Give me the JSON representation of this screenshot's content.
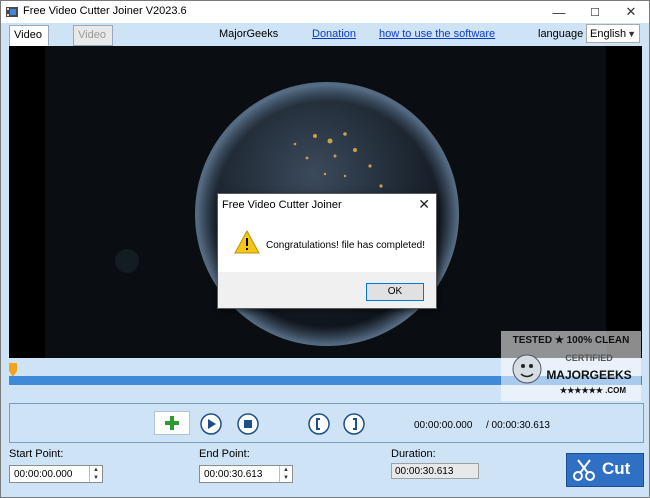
{
  "window": {
    "title": "Free Video Cutter Joiner V2023.6",
    "minimize_icon": "minimize-icon",
    "maximize_icon": "maximize-icon",
    "close_icon": "close-icon"
  },
  "tabs": [
    {
      "label": "Video Cutter",
      "active": true
    },
    {
      "label": "Video Joiner",
      "active": false
    }
  ],
  "topbar": {
    "site": "MajorGeeks",
    "donation": "Donation",
    "howto": "how to use the software",
    "language_label": "language",
    "language_value": "English"
  },
  "dialog": {
    "title": "Congratulations! file has completed!",
    "window_title": "Free Video Cutter Joiner",
    "message": "Congratulations! file has completed!",
    "ok": "OK",
    "icon": "warning-icon"
  },
  "timeline": {
    "position": 0.0
  },
  "controls": {
    "current_time": "00:00:00.000",
    "total_time": "/ 00:00:30.613",
    "icons": [
      "add-icon",
      "play-icon",
      "stop-icon",
      "mark-in-icon",
      "mark-out-icon"
    ]
  },
  "fields": {
    "start_label": "Start Point:",
    "start_value": "00:00:00.000",
    "end_label": "End Point:",
    "end_value": "00:00:30.613",
    "duration_label": "Duration:",
    "duration_value": "00:00:30.613"
  },
  "cut_button": {
    "label": "Cut",
    "icon": "scissors-icon"
  },
  "watermark": {
    "line1": "TESTED ★ 100% CLEAN",
    "line2": "CERTIFIED",
    "line3": "MAJORGEEKS",
    "line4": "★★★★★★ .COM"
  },
  "colors": {
    "accent": "#3f8ad8",
    "window_bg": "#cfe3f7",
    "link": "#0b3dd0"
  }
}
